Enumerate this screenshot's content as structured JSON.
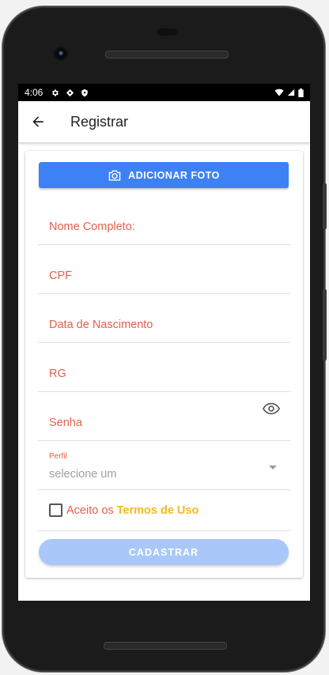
{
  "status_bar": {
    "time": "4:06"
  },
  "app_bar": {
    "title": "Registrar"
  },
  "form": {
    "add_photo_label": "ADICIONAR FOTO",
    "fields": [
      {
        "label": "Nome Completo:"
      },
      {
        "label": "CPF"
      },
      {
        "label": "Data de Nascimento"
      },
      {
        "label": "RG"
      },
      {
        "label": "Senha"
      }
    ],
    "perfil": {
      "label": "Perfil",
      "placeholder": "selecione um"
    },
    "terms": {
      "text": "Aceito os",
      "link": "Termos de Uso"
    },
    "submit_label": "CADASTRAR"
  },
  "colors": {
    "primary": "#3d82f5",
    "label": "#e2614d",
    "link": "#f3b91e",
    "submit_disabled": "#a9c8f9"
  }
}
